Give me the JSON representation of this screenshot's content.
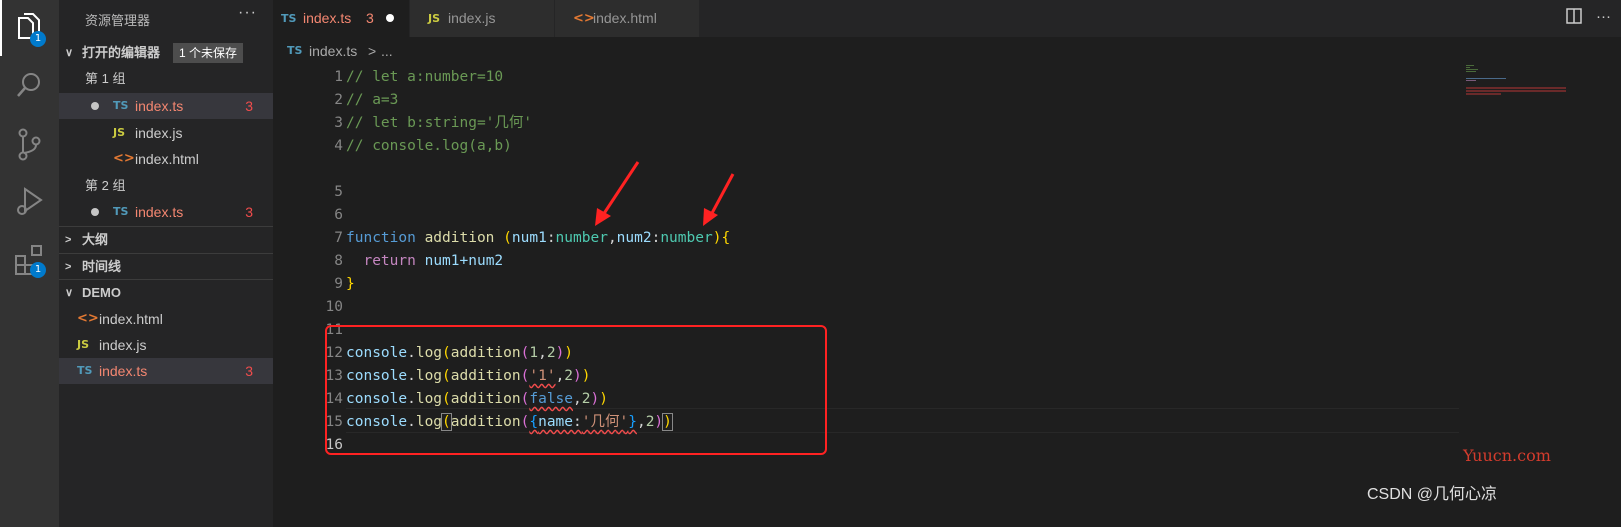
{
  "activity_bar": {
    "explorer_badge": "1",
    "extensions_badge": "1"
  },
  "sidebar": {
    "title": "资源管理器",
    "more": "···",
    "open_editors": {
      "label": "打开的编辑器",
      "unsaved": "1 个未保存",
      "group1": "第 1 组",
      "group2": "第 2 组",
      "g1_files": [
        {
          "name": "index.ts",
          "type": "TS",
          "count": "3"
        },
        {
          "name": "index.js",
          "type": "JS"
        },
        {
          "name": "index.html",
          "type": "<>"
        }
      ],
      "g2_files": [
        {
          "name": "index.ts",
          "type": "TS",
          "count": "3"
        }
      ]
    },
    "outline": "大纲",
    "timeline": "时间线",
    "project": {
      "label": "DEMO",
      "files": [
        {
          "name": "index.html",
          "type": "<>"
        },
        {
          "name": "index.js",
          "type": "JS"
        },
        {
          "name": "index.ts",
          "type": "TS",
          "count": "3"
        }
      ]
    }
  },
  "tabs": [
    {
      "name": "index.ts",
      "type": "TS",
      "count": "3"
    },
    {
      "name": "index.js",
      "type": "JS"
    },
    {
      "name": "index.html",
      "type": "<>"
    }
  ],
  "tab_actions": "··· ",
  "breadcrumb": {
    "type": "TS",
    "file": "index.ts",
    "sep": ">",
    "rest": "..."
  },
  "editor": {
    "line_numbers": [
      "1",
      "2",
      "3",
      "4",
      "5",
      "6",
      "7",
      "8",
      "9",
      "10",
      "11",
      "12",
      "13",
      "14",
      "15",
      "16"
    ],
    "code": {
      "l1": "// let a:number=10",
      "l2": "// a=3",
      "l3": "// let b:string='几何'",
      "l4": "// console.log(a,b)",
      "l8": {
        "kw": "function",
        "fn": "addition",
        "p1": "num1",
        "t1": "number",
        "p2": "num2",
        "t2": "number"
      },
      "l9": {
        "kw": "return",
        "expr": "num1+num2"
      },
      "l13": {
        "obj": "console",
        "m": "log",
        "fn": "addition",
        "a1": "1",
        "a2": "2"
      },
      "l14": {
        "obj": "console",
        "m": "log",
        "fn": "addition",
        "a1": "'1'",
        "a2": "2"
      },
      "l15": {
        "obj": "console",
        "m": "log",
        "fn": "addition",
        "a1": "false",
        "a2": "2"
      },
      "l16": {
        "obj": "console",
        "m": "log",
        "fn": "addition",
        "key": "name",
        "val": "'几何'",
        "a2": "2"
      }
    }
  },
  "watermarks": {
    "site": "Yuucn.com",
    "author": "CSDN @几何心凉"
  },
  "colors": {
    "annotation": "#ff2222",
    "badge": "#007acc"
  }
}
